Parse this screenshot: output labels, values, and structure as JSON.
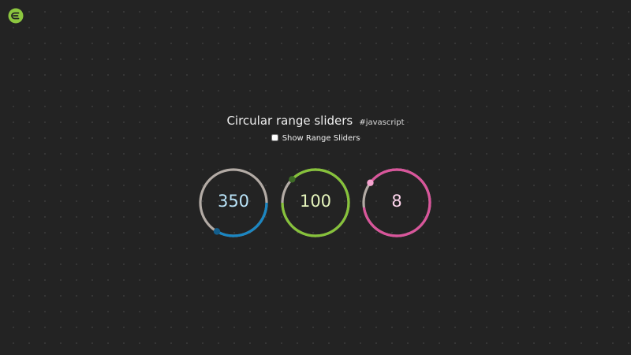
{
  "header": {
    "title": "Circular range sliders",
    "tag": "#javascript"
  },
  "toggle": {
    "label": "Show Range Sliders",
    "checked": false
  },
  "sliders": [
    {
      "value": "350",
      "fraction": 0.375,
      "handle_angle": 210,
      "track_color": "#b3aba5",
      "fill_color": "#1a86c2",
      "handle_color": "#135e8c",
      "value_color": "#b9e3f8",
      "fill_from": "handle-to-right"
    },
    {
      "value": "100",
      "fraction": 0.875,
      "handle_angle": 315,
      "track_color": "#b3aba5",
      "fill_color": "#86c23a",
      "handle_color": "#3d6a26",
      "value_color": "#e4f3bb",
      "fill_from": "handle-ccw"
    },
    {
      "value": "8",
      "fraction": 0.875,
      "handle_angle": 307,
      "track_color": "#b3aba5",
      "fill_color": "#d9559b",
      "handle_color": "#f5a3cf",
      "value_color": "#fbd3ea",
      "fill_from": "handle-ccw"
    }
  ],
  "colors": {
    "background": "#232323",
    "logo": "#8cc63f"
  },
  "icons": {
    "logo": "codepen-style-logo-icon"
  }
}
